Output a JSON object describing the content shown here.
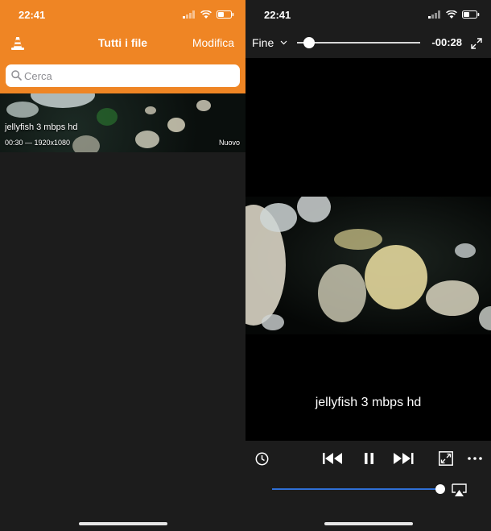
{
  "library": {
    "status": {
      "time": "22:41"
    },
    "nav": {
      "title": "Tutti i file",
      "edit_label": "Modifica"
    },
    "search": {
      "placeholder": "Cerca",
      "value": ""
    },
    "files": [
      {
        "name": "jellyfish 3 mbps hd",
        "meta": "00:30 — 1920x1080",
        "badge": "Nuovo"
      }
    ]
  },
  "player": {
    "status": {
      "time": "22:41"
    },
    "done_label": "Fine",
    "remaining": "-00:28",
    "progress_fraction": 0.07,
    "video_title": "jellyfish 3 mbps hd",
    "volume_fraction": 0.96,
    "icons": {
      "playback_rate": "clock-icon",
      "previous": "skip-back-icon",
      "pause": "pause-icon",
      "next": "skip-forward-icon",
      "aspect": "aspect-ratio-icon",
      "more": "more-icon",
      "airplay": "airplay-icon",
      "fullscreen": "fullscreen-icon"
    }
  },
  "colors": {
    "vlc_orange": "#ef8524",
    "dark_bg": "#1c1c1c",
    "volume_blue": "#2f6fd6"
  }
}
